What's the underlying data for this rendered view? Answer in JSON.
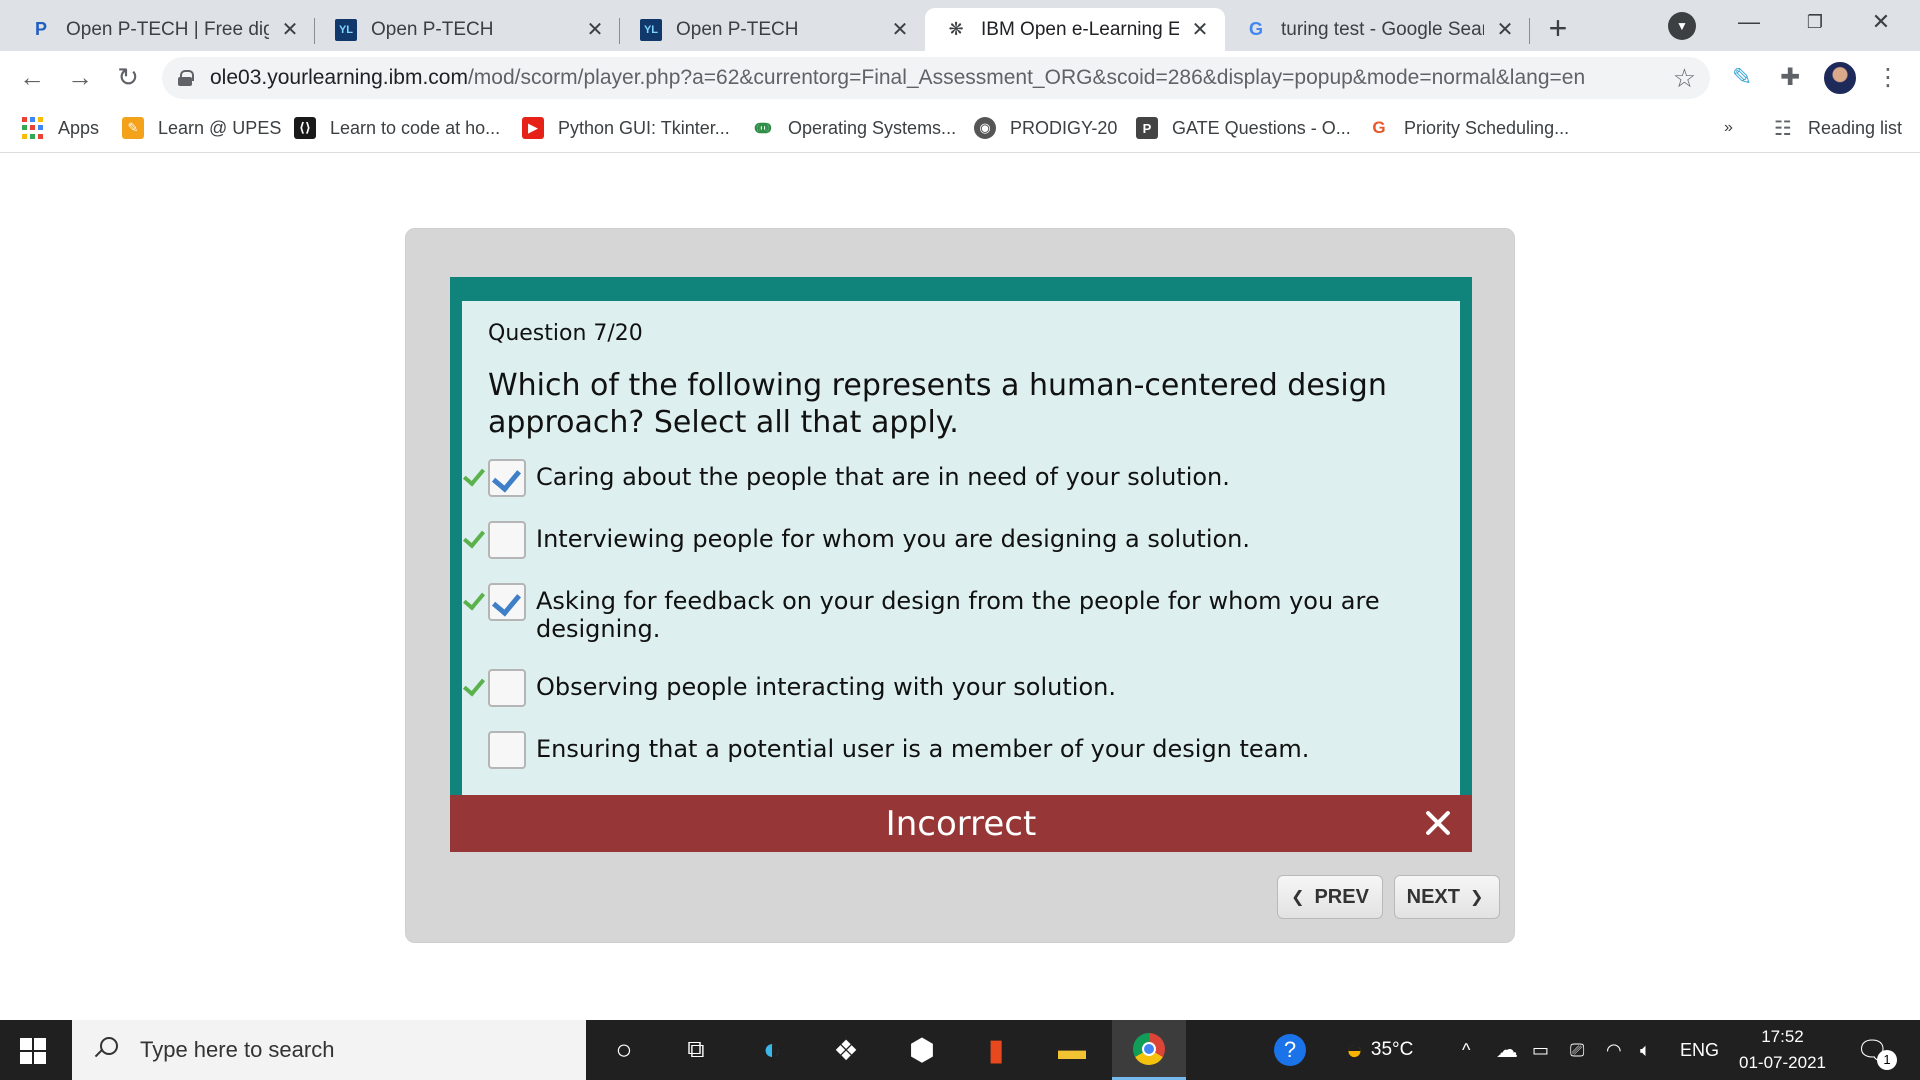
{
  "browser": {
    "tabs": [
      {
        "favicon": "P",
        "label": "Open P-TECH | Free digita",
        "active": false
      },
      {
        "favicon": "YL",
        "label": "Open P-TECH",
        "active": false
      },
      {
        "favicon": "YL",
        "label": "Open P-TECH",
        "active": false
      },
      {
        "favicon": "ibm-bee-icon",
        "label": "IBM Open e-Learning Eco",
        "active": true
      },
      {
        "favicon": "G",
        "label": "turing test - Google Searc",
        "active": false
      }
    ],
    "url_host": "ole03.yourlearning.ibm.com",
    "url_path": "/mod/scorm/player.php?a=62&currentorg=Final_Assessment_ORG&scoid=286&display=popup&mode=normal&lang=en",
    "bookmarks": [
      {
        "label": "Apps",
        "icon": "apps-grid-icon"
      },
      {
        "label": "Learn @ UPES",
        "icon": "pencil-icon"
      },
      {
        "label": "Learn to code at ho...",
        "icon": "code-icon"
      },
      {
        "label": "Python GUI: Tkinter...",
        "icon": "youtube-icon"
      },
      {
        "label": "Operating Systems...",
        "icon": "gfg-icon"
      },
      {
        "label": "PRODIGY-20",
        "icon": "globe-icon"
      },
      {
        "label": "GATE Questions - O...",
        "icon": "p-icon"
      },
      {
        "label": "Priority Scheduling...",
        "icon": "g-icon"
      }
    ],
    "overflow": "»",
    "reading_list": "Reading list"
  },
  "quiz": {
    "question_number": "Question 7/20",
    "question_text": "Which of the following represents a human-centered design approach? Select all that apply.",
    "options": [
      {
        "text": "Caring about the people that are in need of your solution.",
        "checked": true,
        "correct_mark": true
      },
      {
        "text": "Interviewing people for whom you are designing a solution.",
        "checked": false,
        "correct_mark": true
      },
      {
        "text": "Asking for feedback on your design from the people for whom you are designing.",
        "checked": true,
        "correct_mark": true
      },
      {
        "text": "Observing people interacting with your solution.",
        "checked": false,
        "correct_mark": true
      },
      {
        "text": "Ensuring that a potential user is a member of your design team.",
        "checked": false,
        "correct_mark": false
      }
    ],
    "feedback": "Incorrect",
    "prev_label": "PREV",
    "next_label": "NEXT"
  },
  "taskbar": {
    "search_placeholder": "Type here to search",
    "temperature": "35°C",
    "language": "ENG",
    "time": "17:52",
    "date": "01-07-2021",
    "notification_count": "1"
  },
  "colors": {
    "frame_teal": "#10837a",
    "panel_bg": "#ddefef",
    "feedback_red": "#963636",
    "check_blue": "#3f7fc7",
    "correct_green": "#5bb14b"
  }
}
